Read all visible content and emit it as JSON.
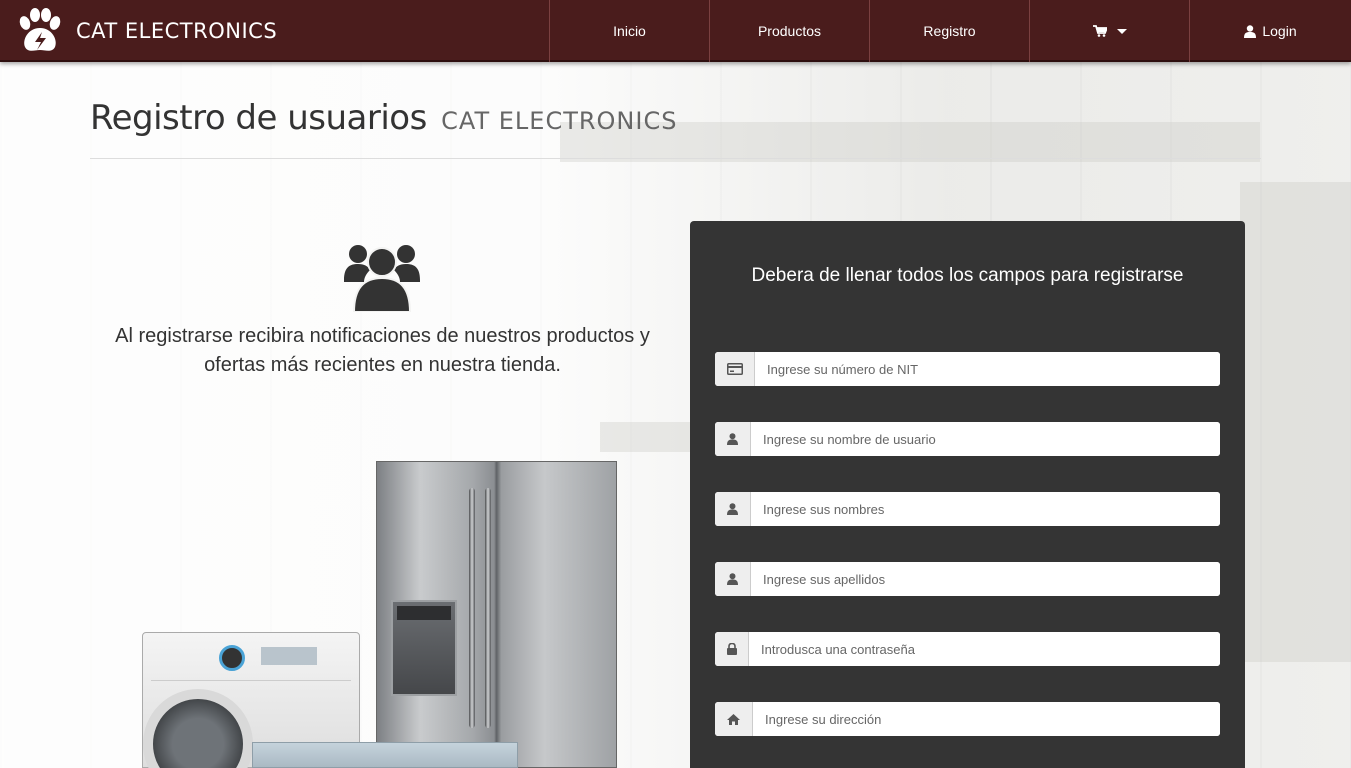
{
  "brand": {
    "name": "CAT ELECTRONICS"
  },
  "nav": {
    "items": [
      {
        "label": "Inicio"
      },
      {
        "label": "Productos"
      },
      {
        "label": "Registro"
      },
      {
        "label": "",
        "icon": "cart-icon"
      },
      {
        "label": "Login",
        "icon": "user-icon"
      }
    ]
  },
  "page": {
    "title": "Registro de usuarios",
    "subtitle": "CAT ELECTRONICS",
    "info_line1": "Al registrarse recibira notificaciones de nuestros productos y",
    "info_line2": "ofertas más recientes en nuestra tienda."
  },
  "form": {
    "title": "Debera de llenar todos los campos para registrarse",
    "fields": [
      {
        "placeholder": "Ingrese su número de NIT",
        "value": "",
        "icon": "credit-card-icon"
      },
      {
        "placeholder": "Ingrese su nombre de usuario",
        "value": "",
        "icon": "user-icon"
      },
      {
        "placeholder": "Ingrese sus nombres",
        "value": "",
        "icon": "user-icon"
      },
      {
        "placeholder": "Ingrese sus apellidos",
        "value": "",
        "icon": "user-icon"
      },
      {
        "placeholder": "Introdusca una contraseña",
        "value": "",
        "icon": "lock-icon"
      },
      {
        "placeholder": "Ingrese su dirección",
        "value": "",
        "icon": "home-icon"
      }
    ]
  },
  "colors": {
    "navbar": "#4a1c1c",
    "form_panel": "#343434"
  }
}
